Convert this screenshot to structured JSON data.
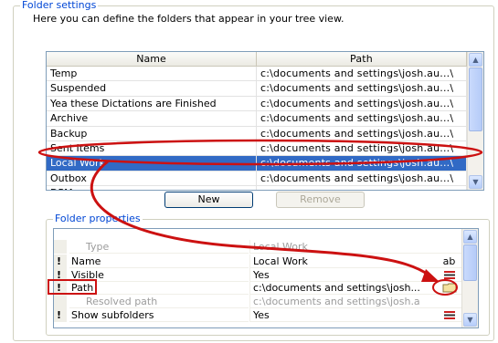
{
  "folder_settings": {
    "title": "Folder settings",
    "description": "Here you can define the folders that appear in your tree view.",
    "columns": [
      "Name",
      "Path"
    ],
    "rows": [
      {
        "name": "Temp",
        "path": "c:\\documents  and  settings\\josh.au...\\"
      },
      {
        "name": "Suspended",
        "path": "c:\\documents  and  settings\\josh.au...\\"
      },
      {
        "name": "Yea these Dictations are Finished",
        "path": "c:\\documents  and  settings\\josh.au...\\"
      },
      {
        "name": "Archive",
        "path": "c:\\documents  and  settings\\josh.au...\\"
      },
      {
        "name": "Backup",
        "path": "c:\\documents  and  settings\\josh.au...\\"
      },
      {
        "name": "Sent Items",
        "path": "c:\\documents  and  settings\\josh.au...\\"
      },
      {
        "name": "Local Work",
        "path": "c:\\documents  and  settings\\josh.au...\\",
        "selected": true
      },
      {
        "name": "Outbox",
        "path": "c:\\documents  and  settings\\josh.au...\\"
      },
      {
        "name": "DPM",
        "path": ""
      }
    ],
    "new_button": "New",
    "remove_button": "Remove"
  },
  "folder_properties": {
    "title": "Folder properties",
    "rows": [
      {
        "required": false,
        "name": "Type",
        "value": "Local Work",
        "readonly": true,
        "extra": ""
      },
      {
        "required": true,
        "name": "Name",
        "value": "Local Work",
        "readonly": false,
        "extra": "ab"
      },
      {
        "required": true,
        "name": "Visible",
        "value": "Yes",
        "readonly": false,
        "extra": "list-icon"
      },
      {
        "required": true,
        "name": "Path",
        "value": "c:\\documents  and  settings\\josh...",
        "readonly": false,
        "extra": "folder-icon"
      },
      {
        "required": false,
        "name": "Resolved path",
        "value": "c:\\documents and settings\\josh.a",
        "readonly": true,
        "extra": ""
      },
      {
        "required": true,
        "name": "Show subfolders",
        "value": "Yes",
        "readonly": false,
        "extra": "list-icon"
      }
    ],
    "required_marker": "!"
  },
  "colors": {
    "accent": "#0046d5",
    "selection": "#316ac5",
    "annotation_red": "#cc1111"
  }
}
